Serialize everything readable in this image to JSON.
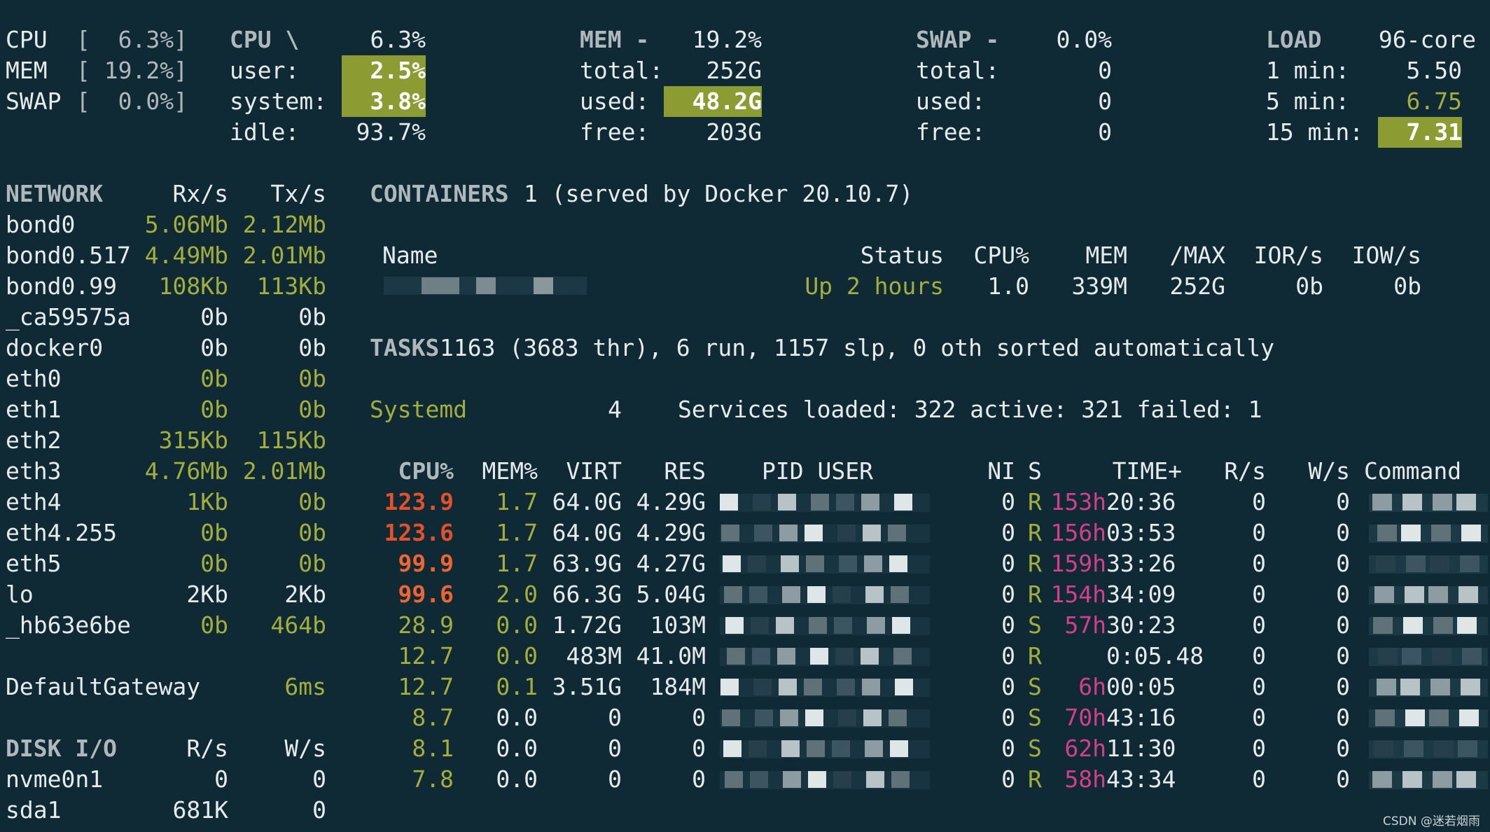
{
  "summary": {
    "cpu_label": "CPU",
    "cpu_bracket": "[  6.3%]",
    "mem_label": "MEM",
    "mem_bracket": "[ 19.2%]",
    "swap_label": "SWAP",
    "swap_bracket": "[  0.0%]"
  },
  "cpu": {
    "title": "CPU \\",
    "total": "6.3%",
    "user_label": "user:",
    "user": "2.5%",
    "system_label": "system:",
    "system": "3.8%",
    "idle_label": "idle:",
    "idle": "93.7%"
  },
  "mem": {
    "title": "MEM -",
    "percent": "19.2%",
    "total_label": "total:",
    "total": "252G",
    "used_label": "used:",
    "used": "48.2G",
    "free_label": "free:",
    "free": "203G"
  },
  "swap": {
    "title": "SWAP -",
    "percent": "0.0%",
    "total_label": "total:",
    "total": "0",
    "used_label": "used:",
    "used": "0",
    "free_label": "free:",
    "free": "0"
  },
  "load": {
    "title": "LOAD",
    "cores": "96-core",
    "min1_label": "1 min:",
    "min1": "5.50",
    "min5_label": "5 min:",
    "min5": "6.75",
    "min15_label": "15 min:",
    "min15": "7.31"
  },
  "network": {
    "title": "NETWORK",
    "rx_label": "Rx/s",
    "tx_label": "Tx/s",
    "rows": [
      {
        "name": "bond0",
        "rx": "5.06Mb",
        "tx": "2.12Mb",
        "hl": true
      },
      {
        "name": "bond0.517",
        "rx": "4.49Mb",
        "tx": "2.01Mb",
        "hl": true
      },
      {
        "name": "bond0.99",
        "rx": "108Kb",
        "tx": "113Kb",
        "hl": true
      },
      {
        "name": "_ca59575a",
        "rx": "0b",
        "tx": "0b",
        "hl": false
      },
      {
        "name": "docker0",
        "rx": "0b",
        "tx": "0b",
        "hl": false
      },
      {
        "name": "eth0",
        "rx": "0b",
        "tx": "0b",
        "hl": true
      },
      {
        "name": "eth1",
        "rx": "0b",
        "tx": "0b",
        "hl": true
      },
      {
        "name": "eth2",
        "rx": "315Kb",
        "tx": "115Kb",
        "hl": true
      },
      {
        "name": "eth3",
        "rx": "4.76Mb",
        "tx": "2.01Mb",
        "hl": true
      },
      {
        "name": "eth4",
        "rx": "1Kb",
        "tx": "0b",
        "hl": true
      },
      {
        "name": "eth4.255",
        "rx": "0b",
        "tx": "0b",
        "hl": true
      },
      {
        "name": "eth5",
        "rx": "0b",
        "tx": "0b",
        "hl": true
      },
      {
        "name": "lo",
        "rx": "2Kb",
        "tx": "2Kb",
        "hl": false
      },
      {
        "name": "_hb63e6be",
        "rx": "0b",
        "tx": "464b",
        "hl": true
      }
    ]
  },
  "gateway": {
    "label": "DefaultGateway",
    "value": "6ms"
  },
  "disk": {
    "title": "DISK I/O",
    "r_label": "R/s",
    "w_label": "W/s",
    "rows": [
      {
        "name": "nvme0n1",
        "r": "0",
        "w": "0"
      },
      {
        "name": "sda1",
        "r": "681K",
        "w": "0"
      }
    ]
  },
  "containers": {
    "title": "CONTAINERS",
    "info": "1 (served by Docker 20.10.7)",
    "headers": {
      "name": "Name",
      "status": "Status",
      "cpu": "CPU%",
      "mem": "MEM",
      "max": "/MAX",
      "ior": "IOR/s",
      "iow": "IOW/s"
    },
    "row": {
      "status": "Up 2 hours",
      "cpu": "1.0",
      "mem": "339M",
      "max": "252G",
      "ior": "0b",
      "iow": "0b"
    }
  },
  "tasks": {
    "title": "TASKS",
    "info": "1163 (3683 thr), 6 run, 1157 slp, 0 oth sorted automatically"
  },
  "systemd": {
    "label": "Systemd",
    "count": "4",
    "services": "Services loaded: 322 active: 321 failed: 1"
  },
  "processes": {
    "headers": {
      "cpu": "CPU%",
      "mem": "MEM%",
      "virt": "VIRT",
      "res": "RES",
      "pid_user": "PID USER",
      "ni": "NI",
      "s": "S",
      "time": "TIME+",
      "rs": "R/s",
      "ws": "W/s",
      "command": "Command"
    },
    "rows": [
      {
        "cpu": "123.9",
        "mem": "1.7",
        "virt": "64.0G",
        "res": "4.29G",
        "ni": "0",
        "s": "R",
        "th": "153h",
        "tm": "20:36",
        "rs": "0",
        "ws": "0",
        "cpu_level": "red",
        "mem_hl": true
      },
      {
        "cpu": "123.6",
        "mem": "1.7",
        "virt": "64.0G",
        "res": "4.29G",
        "ni": "0",
        "s": "R",
        "th": "156h",
        "tm": "03:53",
        "rs": "0",
        "ws": "0",
        "cpu_level": "red",
        "mem_hl": true
      },
      {
        "cpu": "99.9",
        "mem": "1.7",
        "virt": "63.9G",
        "res": "4.27G",
        "ni": "0",
        "s": "R",
        "th": "159h",
        "tm": "33:26",
        "rs": "0",
        "ws": "0",
        "cpu_level": "orange",
        "mem_hl": true
      },
      {
        "cpu": "99.6",
        "mem": "2.0",
        "virt": "66.3G",
        "res": "5.04G",
        "ni": "0",
        "s": "R",
        "th": "154h",
        "tm": "34:09",
        "rs": "0",
        "ws": "0",
        "cpu_level": "orange",
        "mem_hl": true
      },
      {
        "cpu": "28.9",
        "mem": "0.0",
        "virt": "1.72G",
        "res": "103M",
        "ni": "0",
        "s": "S",
        "th": "57h",
        "tm": "30:23",
        "rs": "0",
        "ws": "0",
        "cpu_level": "green",
        "mem_hl": true
      },
      {
        "cpu": "12.7",
        "mem": "0.0",
        "virt": "483M",
        "res": "41.0M",
        "ni": "0",
        "s": "R",
        "th": "",
        "tm": "0:05.48",
        "rs": "0",
        "ws": "0",
        "cpu_level": "green",
        "mem_hl": true
      },
      {
        "cpu": "12.7",
        "mem": "0.1",
        "virt": "3.51G",
        "res": "184M",
        "ni": "0",
        "s": "S",
        "th": "6h",
        "tm": "00:05",
        "rs": "0",
        "ws": "0",
        "cpu_level": "green",
        "mem_hl": true
      },
      {
        "cpu": "8.7",
        "mem": "0.0",
        "virt": "0",
        "res": "0",
        "ni": "0",
        "s": "S",
        "th": "70h",
        "tm": "43:16",
        "rs": "0",
        "ws": "0",
        "cpu_level": "green",
        "mem_hl": false
      },
      {
        "cpu": "8.1",
        "mem": "0.0",
        "virt": "0",
        "res": "0",
        "ni": "0",
        "s": "S",
        "th": "62h",
        "tm": "11:30",
        "rs": "0",
        "ws": "0",
        "cpu_level": "green",
        "mem_hl": false
      },
      {
        "cpu": "7.8",
        "mem": "0.0",
        "virt": "0",
        "res": "0",
        "ni": "0",
        "s": "R",
        "th": "58h",
        "tm": "43:34",
        "rs": "0",
        "ws": "0",
        "cpu_level": "green",
        "mem_hl": false
      }
    ]
  },
  "watermark": "CSDN @迷若烟雨",
  "colors": {
    "background": "#102a35",
    "text": "#e6ecee",
    "header": "#aeb8bd",
    "green": "#a2ae3d",
    "highlight_bg": "#8d9c32",
    "critical": "#e0512c",
    "magenta": "#d33f8c"
  }
}
